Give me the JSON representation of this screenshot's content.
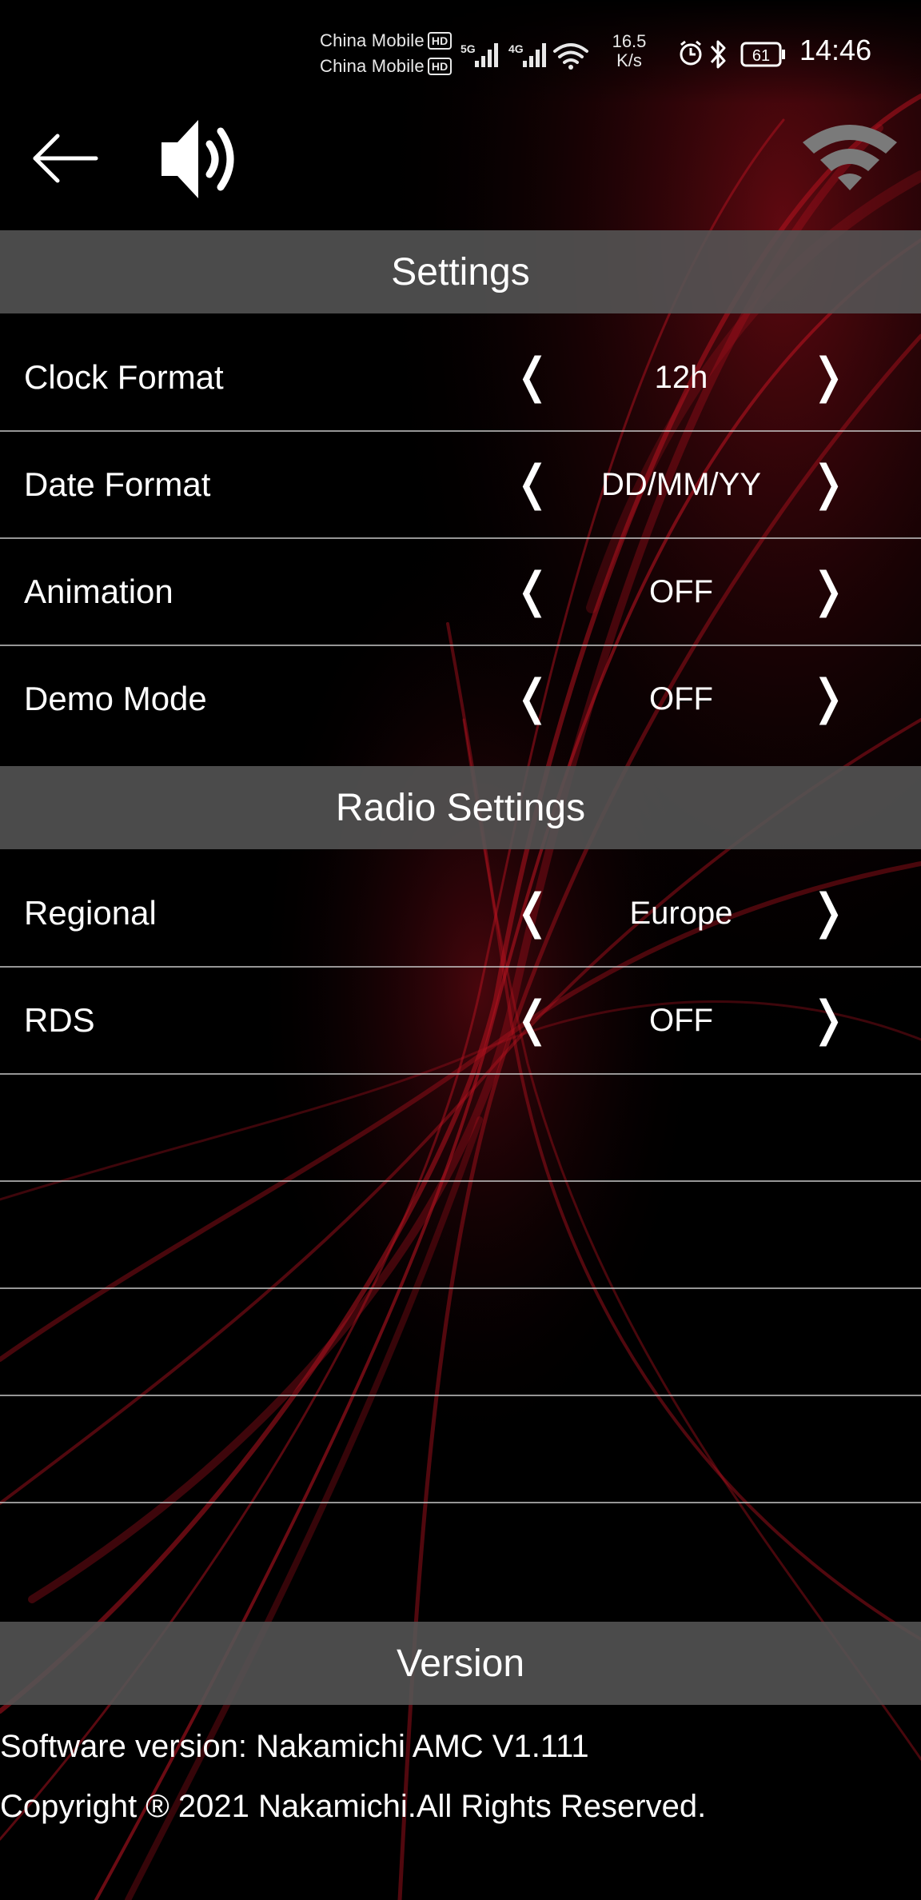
{
  "status_bar": {
    "carrier_1": "China Mobile",
    "carrier_2": "China Mobile",
    "hd_badge": "HD",
    "network_1": "5G",
    "network_2": "4G",
    "net_speed_value": "16.5",
    "net_speed_unit": "K/s",
    "battery": "61",
    "time": "14:46"
  },
  "header": {
    "back_icon": "arrow-left-icon",
    "volume_icon": "speaker-volume-icon",
    "wifi_icon": "wifi-icon"
  },
  "settings": {
    "title": "Settings",
    "rows": [
      {
        "label": "Clock Format",
        "value": "12h"
      },
      {
        "label": "Date Format",
        "value": "DD/MM/YY"
      },
      {
        "label": "Animation",
        "value": "OFF"
      },
      {
        "label": "Demo Mode",
        "value": "OFF"
      }
    ]
  },
  "radio_settings": {
    "title": "Radio Settings",
    "rows": [
      {
        "label": "Regional",
        "value": "Europe"
      },
      {
        "label": "RDS",
        "value": "OFF"
      }
    ]
  },
  "version": {
    "title": "Version",
    "software": "Software version: Nakamichi AMC V1.111",
    "copyright": "Copyright ® 2021 Nakamichi.All Rights Reserved."
  },
  "arrows": {
    "prev": "❬",
    "next": "❭"
  },
  "colors": {
    "background": "#000000",
    "accent": "#c0101c",
    "section_header": "#555555"
  }
}
